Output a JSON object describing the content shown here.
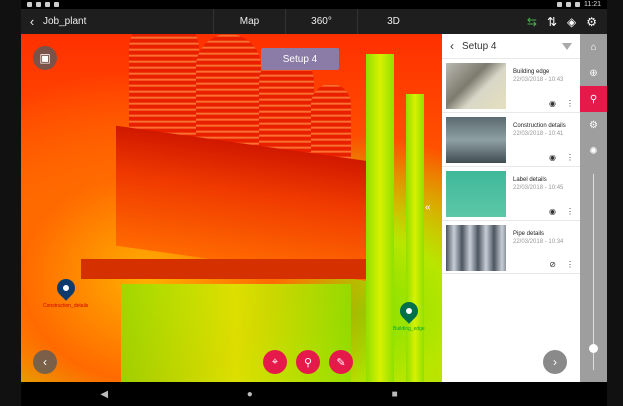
{
  "status_bar": {
    "time": "11:21"
  },
  "app_bar": {
    "back_icon": "chevron-left-icon",
    "project_title": "Job_plant",
    "tabs": [
      {
        "label": "Map"
      },
      {
        "label": "360°"
      },
      {
        "label": "3D"
      }
    ],
    "tool_icons": [
      "sync-icon",
      "sort-icon",
      "layers-icon",
      "gear-icon"
    ]
  },
  "viewport": {
    "setup_chip": "Setup 4",
    "markers": [
      {
        "label": "Construction_details",
        "color": "#0d3b6e"
      },
      {
        "label": "Building_edge",
        "color": "#00704a"
      }
    ],
    "collapse_icon": "double-chevron-left-icon",
    "fabs": [
      "target-icon",
      "pin-icon",
      "ruler-icon"
    ],
    "accent": "#e6194b"
  },
  "panel": {
    "title": "Setup 4",
    "items": [
      {
        "name": "Building edge",
        "date": "22/03/2018 - 10:43",
        "visibility": "eye-icon"
      },
      {
        "name": "Construction details",
        "date": "22/03/2018 - 10:41",
        "visibility": "eye-icon"
      },
      {
        "name": "Label details",
        "date": "22/03/2018 - 10:45",
        "visibility": "eye-icon"
      },
      {
        "name": "Pipe details",
        "date": "22/03/2018 - 10:34",
        "visibility": "eye-off-icon"
      }
    ]
  },
  "rail": {
    "buttons": [
      "scanner-icon",
      "download-icon",
      "pin-icon",
      "gear-icon",
      "aperture-icon"
    ],
    "active_index": 2
  },
  "nav_bar": {
    "buttons": [
      "back-triangle-icon",
      "home-circle-icon",
      "recents-square-icon"
    ]
  }
}
